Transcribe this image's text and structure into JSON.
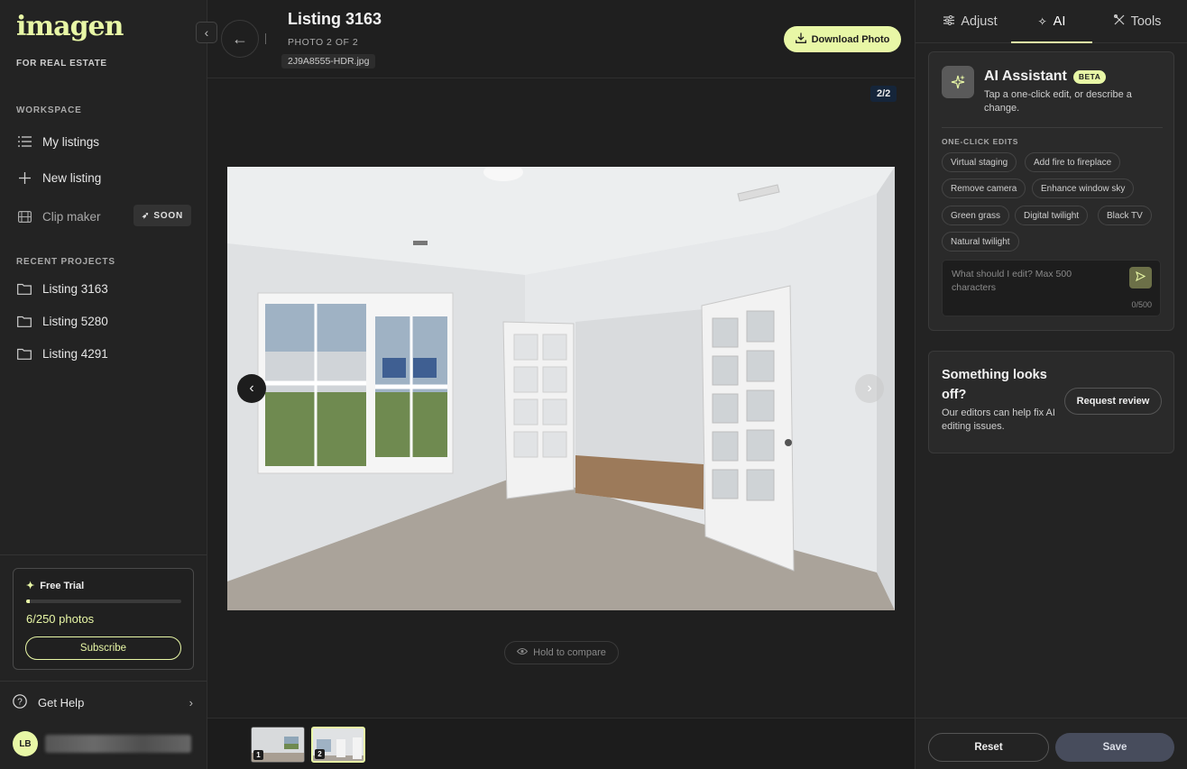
{
  "brand": {
    "logo": "imagen",
    "tagline": "FOR REAL ESTATE"
  },
  "sidebar": {
    "workspace_title": "WORKSPACE",
    "workspace_items": [
      {
        "label": "My listings",
        "icon": "list-icon"
      },
      {
        "label": "New listing",
        "icon": "plus-icon"
      },
      {
        "label": "Clip maker",
        "icon": "film-icon",
        "badge": "SOON"
      }
    ],
    "recent_title": "RECENT PROJECTS",
    "recent_items": [
      {
        "label": "Listing 3163",
        "icon": "folder-icon"
      },
      {
        "label": "Listing 5280",
        "icon": "folder-icon"
      },
      {
        "label": "Listing 4291",
        "icon": "folder-icon"
      }
    ],
    "trial": {
      "title": "Free Trial",
      "count_text": "6/250 photos",
      "used": 6,
      "total": 250,
      "cta": "Subscribe"
    },
    "help_label": "Get Help",
    "user": {
      "initials": "LB"
    }
  },
  "header": {
    "title": "Listing 3163",
    "photo_position": "PHOTO 2 OF 2",
    "filename": "2J9A8555-HDR.jpg",
    "download_label": "Download Photo"
  },
  "viewer": {
    "counter": "2/2",
    "compare_label": "Hold to compare",
    "thumbnails": [
      {
        "num": "1"
      },
      {
        "num": "2",
        "active": true
      }
    ]
  },
  "panel": {
    "tabs": [
      {
        "label": "Adjust",
        "icon": "sliders-icon"
      },
      {
        "label": "AI",
        "icon": "sparkles-icon",
        "active": true
      },
      {
        "label": "Tools",
        "icon": "tools-icon"
      }
    ],
    "ai": {
      "title": "AI Assistant",
      "badge": "BETA",
      "description": "Tap a one-click edit, or describe a change.",
      "edits_title": "ONE-CLICK EDITS",
      "edits": [
        "Virtual staging",
        "Add fire to fireplace",
        "Remove camera",
        "Enhance window sky",
        "Green grass",
        "Digital twilight",
        "Black TV",
        "Natural twilight"
      ],
      "prompt_placeholder": "What should I edit? Max 500 characters",
      "prompt_count": "0/500"
    },
    "review": {
      "title": "Something looks off?",
      "description": "Our editors can help fix AI editing issues.",
      "button": "Request review"
    },
    "reset_label": "Reset",
    "save_label": "Save"
  },
  "colors": {
    "accent": "#e8f7a6",
    "background": "#1f1f1f",
    "save": "#474c5c"
  }
}
